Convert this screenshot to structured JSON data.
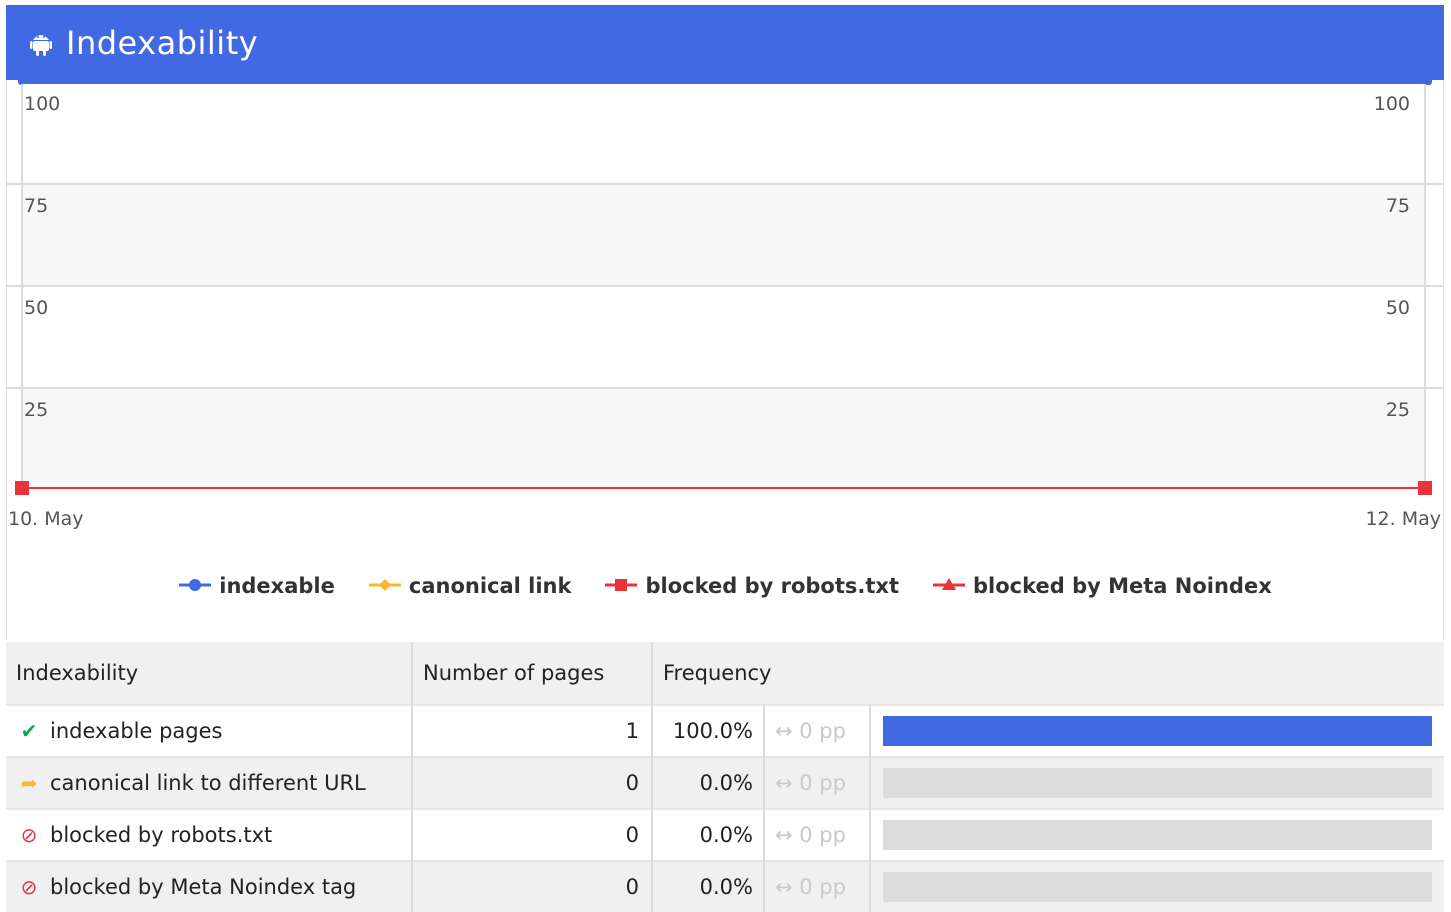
{
  "header": {
    "title": "Indexability",
    "icon": "android-icon",
    "color": "#4169e1"
  },
  "chart_data": {
    "type": "line",
    "x": [
      "10. May",
      "12. May"
    ],
    "ylim": [
      0,
      100
    ],
    "yticks": [
      25,
      50,
      75,
      100
    ],
    "series": [
      {
        "name": "indexable",
        "values": [
          0,
          0
        ],
        "color": "#4169e1",
        "marker": "circle"
      },
      {
        "name": "canonical link",
        "values": [
          0,
          0
        ],
        "color": "#f7b731",
        "marker": "diamond"
      },
      {
        "name": "blocked by robots.txt",
        "values": [
          0,
          0
        ],
        "color": "#e8333a",
        "marker": "square"
      },
      {
        "name": "blocked by Meta Noindex",
        "values": [
          0,
          0
        ],
        "color": "#e8333a",
        "marker": "triangle"
      }
    ],
    "legend_position": "bottom-center",
    "grid": true
  },
  "table": {
    "headers": [
      "Indexability",
      "Number of pages",
      "Frequency"
    ],
    "rows": [
      {
        "icon": "checkmark-icon",
        "icon_glyph": "✔",
        "icon_color": "#1aa05b",
        "label": "indexable pages",
        "count": "1",
        "freq": "100.0%",
        "delta": "↔ 0 pp",
        "share": 1.0
      },
      {
        "icon": "redirect-arrow-icon",
        "icon_glyph": "➦",
        "icon_color": "#f7b731",
        "label": "canonical link to different URL",
        "count": "0",
        "freq": "0.0%",
        "delta": "↔ 0 pp",
        "share": 0.0
      },
      {
        "icon": "blocked-icon",
        "icon_glyph": "⊘",
        "icon_color": "#e8333a",
        "label": "blocked by robots.txt",
        "count": "0",
        "freq": "0.0%",
        "delta": "↔ 0 pp",
        "share": 0.0
      },
      {
        "icon": "blocked-icon",
        "icon_glyph": "⊘",
        "icon_color": "#e8333a",
        "label": "blocked by Meta Noindex tag",
        "count": "0",
        "freq": "0.0%",
        "delta": "↔ 0 pp",
        "share": 0.0
      }
    ]
  }
}
